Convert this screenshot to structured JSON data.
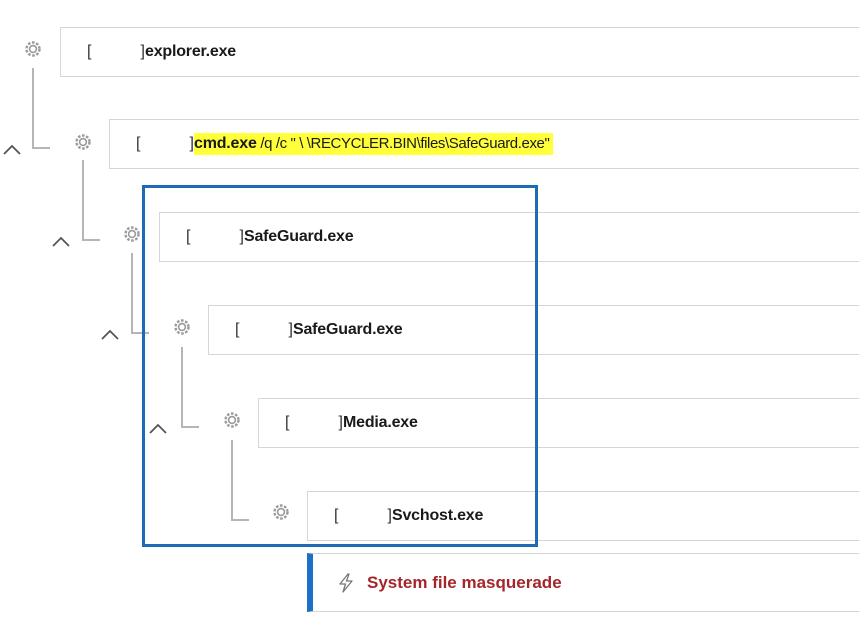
{
  "process_tree": [
    {
      "pid": "",
      "name": "explorer.exe",
      "args": "",
      "highlighted": false
    },
    {
      "pid": "",
      "name": "cmd.exe",
      "args": " /q /c \" \\ \\RECYCLER.BIN\\files\\SafeGuard.exe\"",
      "highlighted": true
    },
    {
      "pid": "",
      "name": "SafeGuard.exe",
      "args": "",
      "highlighted": false
    },
    {
      "pid": "",
      "name": "SafeGuard.exe",
      "args": "",
      "highlighted": false
    },
    {
      "pid": "",
      "name": "Media.exe",
      "args": "",
      "highlighted": false
    },
    {
      "pid": "",
      "name": "Svchost.exe",
      "args": "",
      "highlighted": false
    }
  ],
  "alert": {
    "icon": "lightning-icon",
    "title": "System file masquerade"
  },
  "icons": {
    "process": "gear-icon",
    "collapse": "chevron-up-icon"
  },
  "colors": {
    "highlight": "#ffff3a",
    "selection_box": "#1d6bb5",
    "alert_text": "#a4262c",
    "alert_accent": "#1e6fc7"
  }
}
